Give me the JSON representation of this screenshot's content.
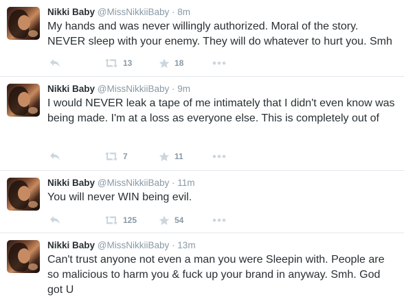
{
  "tweets": [
    {
      "name": "Nikki Baby",
      "handle": "@MissNikkiiBaby",
      "dot": "·",
      "time": "8m",
      "text": "My hands and was never willingly authorized. Moral of the story. NEVER sleep with your enemy. They will do whatever to hurt you. Smh",
      "retweets": "13",
      "favorites": "18"
    },
    {
      "name": "Nikki Baby",
      "handle": "@MissNikkiiBaby",
      "dot": "·",
      "time": "9m",
      "text": "I would NEVER leak a tape of me intimately that I didn't even know was being made. I'm at a loss as everyone else. This is completely out of",
      "retweets": "7",
      "favorites": "11"
    },
    {
      "name": "Nikki Baby",
      "handle": "@MissNikkiiBaby",
      "dot": "·",
      "time": "11m",
      "text": "You will never WIN being evil.",
      "retweets": "125",
      "favorites": "54"
    },
    {
      "name": "Nikki Baby",
      "handle": "@MissNikkiiBaby",
      "dot": "·",
      "time": "13m",
      "text": "Can't trust anyone not even a man you were Sleepin with. People are so malicious to harm you & fuck up your brand in anyway. Smh. God got U"
    }
  ],
  "icons": {
    "reply": "reply-icon",
    "retweet": "retweet-icon",
    "favorite": "star-icon",
    "more": "more-icon"
  },
  "colors": {
    "name": "#292f33",
    "meta": "#8899a6",
    "icon": "#ccd6dd",
    "divider": "#e1e8ed"
  }
}
